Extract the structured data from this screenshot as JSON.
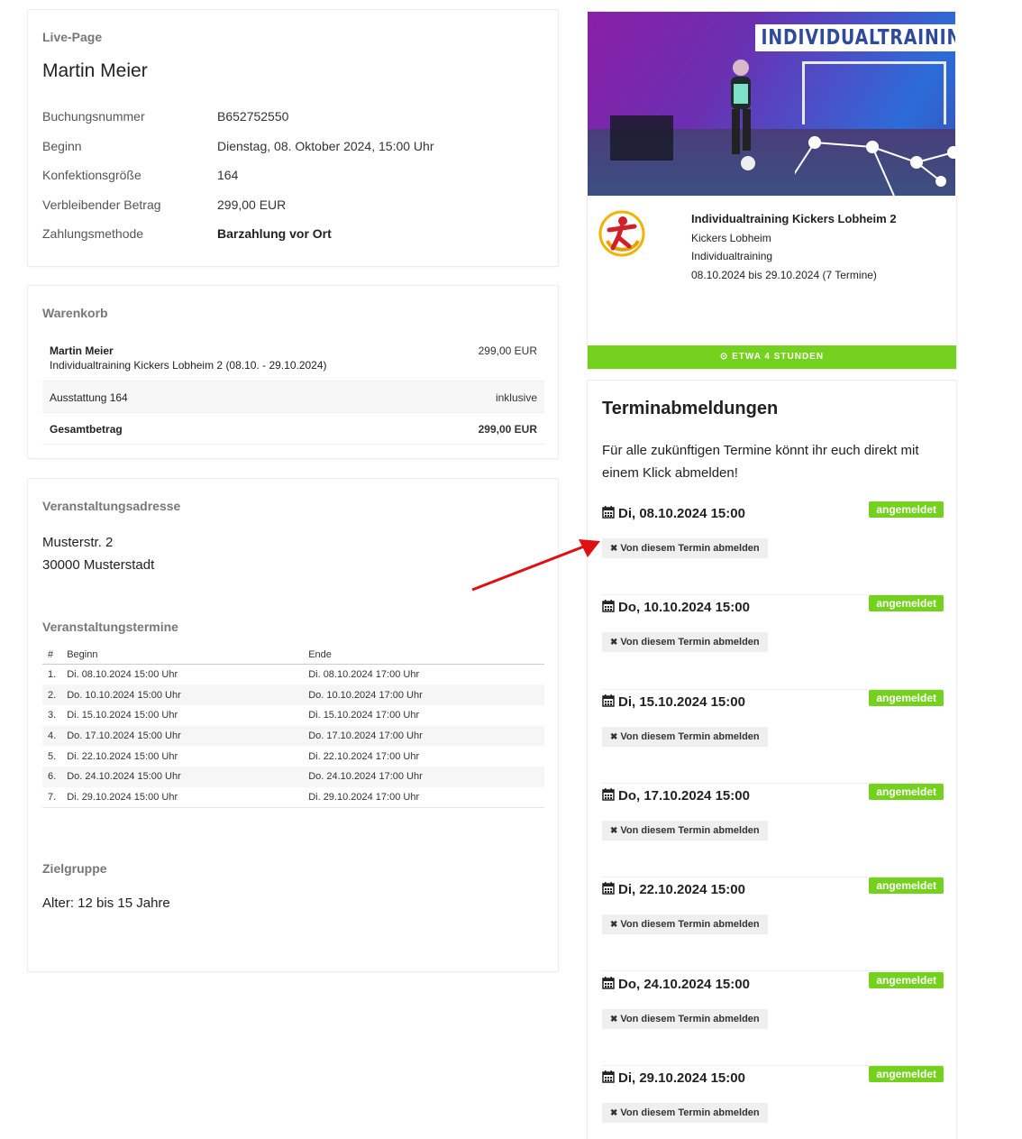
{
  "live": {
    "section_label": "Live-Page",
    "name": "Martin Meier",
    "fields": [
      {
        "label": "Buchungsnummer",
        "value": "B652752550"
      },
      {
        "label": "Beginn",
        "value": "Dienstag, 08. Oktober 2024, 15:00 Uhr"
      },
      {
        "label": "Konfektionsgröße",
        "value": "164"
      },
      {
        "label": "Verbleibender Betrag",
        "value": "299,00 EUR"
      },
      {
        "label": "Zahlungsmethode",
        "value": "Barzahlung vor Ort"
      }
    ]
  },
  "cart": {
    "section_label": "Warenkorb",
    "item_name": "Martin Meier",
    "item_desc": "Individualtraining Kickers Lobheim 2 (08.10. - 29.10.2024)",
    "item_price": "299,00 EUR",
    "extra_label": "Ausstattung 164",
    "extra_value": "inklusive",
    "total_label": "Gesamtbetrag",
    "total_value": "299,00 EUR"
  },
  "address": {
    "section_label": "Veranstaltungsadresse",
    "street": "Musterstr. 2",
    "city": "30000 Musterstadt"
  },
  "dates": {
    "section_label": "Veranstaltungstermine",
    "headers": [
      "#",
      "Beginn",
      "Ende"
    ],
    "rows": [
      [
        "1.",
        "Di. 08.10.2024 15:00 Uhr",
        "Di. 08.10.2024 17:00 Uhr"
      ],
      [
        "2.",
        "Do. 10.10.2024 15:00 Uhr",
        "Do. 10.10.2024 17:00 Uhr"
      ],
      [
        "3.",
        "Di. 15.10.2024 15:00 Uhr",
        "Di. 15.10.2024 17:00 Uhr"
      ],
      [
        "4.",
        "Do. 17.10.2024 15:00 Uhr",
        "Do. 17.10.2024 17:00 Uhr"
      ],
      [
        "5.",
        "Di. 22.10.2024 15:00 Uhr",
        "Di. 22.10.2024 17:00 Uhr"
      ],
      [
        "6.",
        "Do. 24.10.2024 15:00 Uhr",
        "Do. 24.10.2024 17:00 Uhr"
      ],
      [
        "7.",
        "Di. 29.10.2024 15:00 Uhr",
        "Di. 29.10.2024 17:00 Uhr"
      ]
    ]
  },
  "target": {
    "section_label": "Zielgruppe",
    "value": "Alter: 12 bis 15 Jahre"
  },
  "event": {
    "banner_title": "INDIVIDUALTRAINING",
    "title": "Individualtraining Kickers Lobheim 2",
    "club": "Kickers Lobheim",
    "type": "Individualtraining",
    "range": "08.10.2024 bis 29.10.2024 (7 Termine)",
    "duration": "ETWA 4 STUNDEN",
    "accent_color": "#74d11e"
  },
  "termine": {
    "title": "Terminabmeldungen",
    "intro": "Für alle zukünftigen Termine könnt ihr euch direkt mit einem Klick abmelden!",
    "badge_label": "angemeldet",
    "button_label": "Von diesem Termin abmelden",
    "items": [
      "Di, 08.10.2024 15:00",
      "Do, 10.10.2024 15:00",
      "Di, 15.10.2024 15:00",
      "Do, 17.10.2024 15:00",
      "Di, 22.10.2024 15:00",
      "Do, 24.10.2024 15:00",
      "Di, 29.10.2024 15:00"
    ]
  }
}
